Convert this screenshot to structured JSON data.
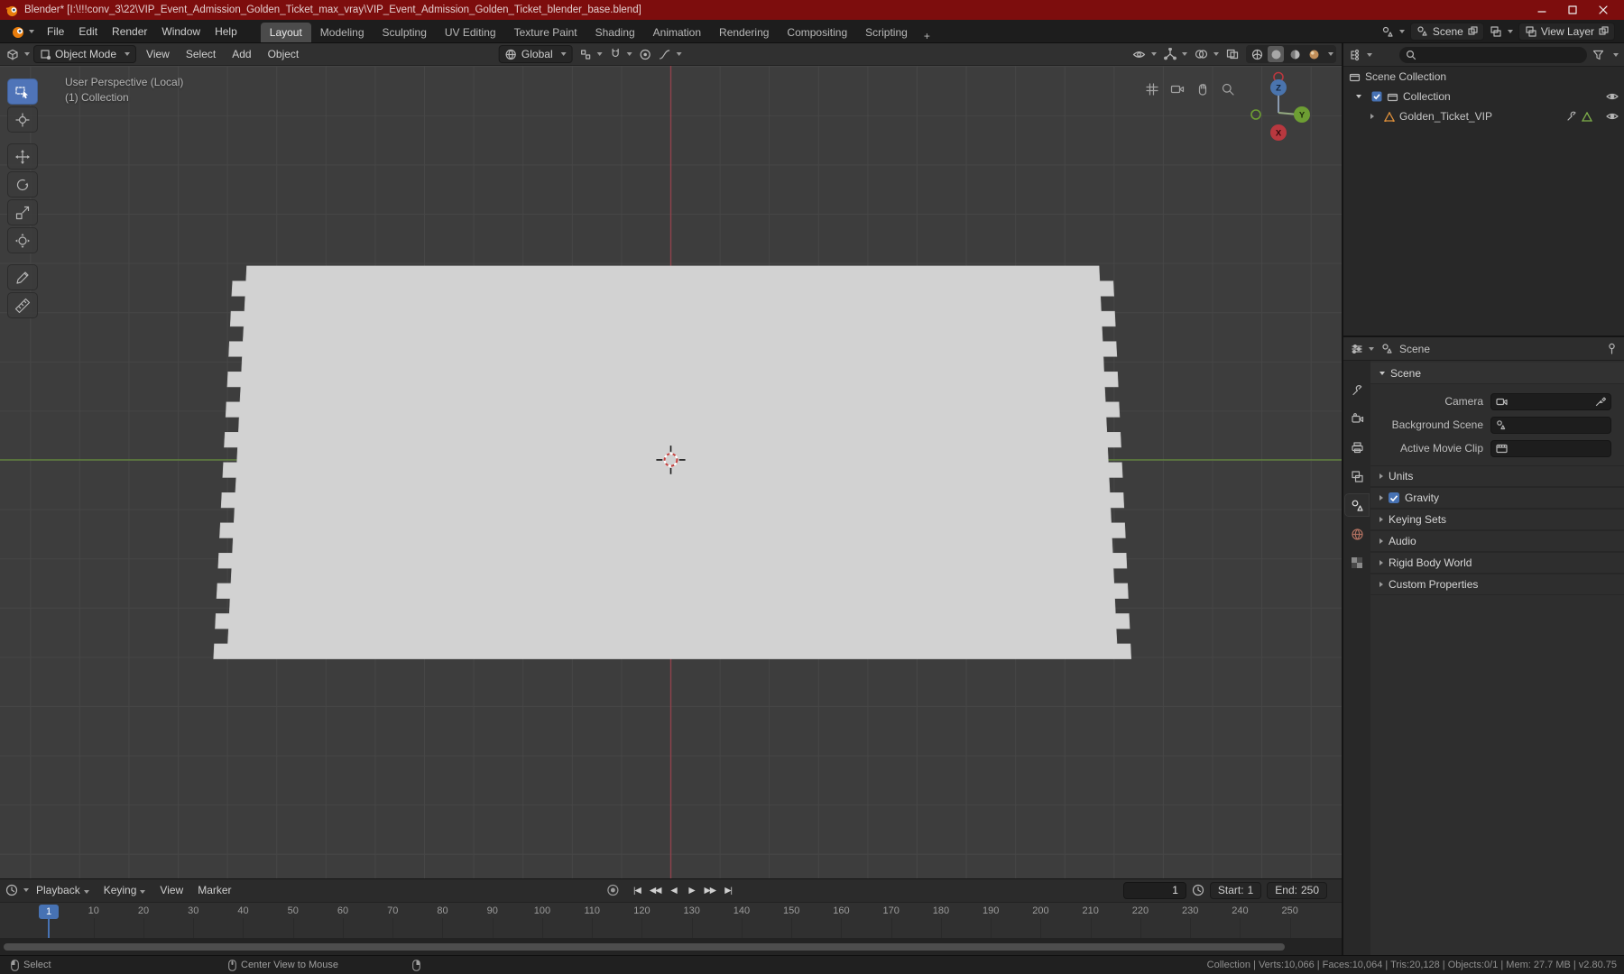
{
  "titlebar": {
    "title": "Blender* [I:\\!!!conv_3\\22\\VIP_Event_Admission_Golden_Ticket_max_vray\\VIP_Event_Admission_Golden_Ticket_blender_base.blend]"
  },
  "menubar": {
    "menus": [
      "File",
      "Edit",
      "Render",
      "Window",
      "Help"
    ],
    "workspaces": [
      "Layout",
      "Modeling",
      "Sculpting",
      "UV Editing",
      "Texture Paint",
      "Shading",
      "Animation",
      "Rendering",
      "Compositing",
      "Scripting"
    ],
    "active_workspace": "Layout",
    "add_tab": "+",
    "scene_selector": "Scene",
    "view_layer_selector": "View Layer"
  },
  "viewport_header": {
    "mode": "Object Mode",
    "menus": [
      "View",
      "Select",
      "Add",
      "Object"
    ],
    "orientation": "Global"
  },
  "viewport_overlay": {
    "line1": "User Perspective (Local)",
    "line2": "(1) Collection"
  },
  "gizmo": {
    "x": "X",
    "y": "Y",
    "z": "Z"
  },
  "outliner": {
    "rows": [
      {
        "label": "Scene Collection"
      },
      {
        "label": "Collection"
      },
      {
        "label": "Golden_Ticket_VIP"
      }
    ]
  },
  "properties": {
    "breadcrumb": "Scene",
    "scene_panel": {
      "title": "Scene",
      "fields": [
        {
          "label": "Camera"
        },
        {
          "label": "Background Scene"
        },
        {
          "label": "Active Movie Clip"
        }
      ]
    },
    "collapsed_panels": [
      {
        "label": "Units"
      },
      {
        "label": "Gravity",
        "checked": true
      },
      {
        "label": "Keying Sets"
      },
      {
        "label": "Audio"
      },
      {
        "label": "Rigid Body World"
      },
      {
        "label": "Custom Properties"
      }
    ]
  },
  "timeline": {
    "menus": [
      "Playback",
      "Keying",
      "View",
      "Marker"
    ],
    "transport": [
      "|◀",
      "◀◀",
      "◀",
      "▶",
      "▶▶",
      "▶|"
    ],
    "current_frame": "1",
    "start_label": "Start:",
    "start_value": "1",
    "end_label": "End:",
    "end_value": "250",
    "playhead_frame": "1",
    "ticks": [
      10,
      20,
      30,
      40,
      50,
      60,
      70,
      80,
      90,
      100,
      110,
      120,
      130,
      140,
      150,
      160,
      170,
      180,
      190,
      200,
      210,
      220,
      230,
      240,
      250
    ]
  },
  "statusbar": {
    "select_label": "Select",
    "center_view_label": "Center View to Mouse",
    "stats": "Collection | Verts:10,066 | Faces:10,064 | Tris:20,128 | Objects:0/1 | Mem: 27.7 MB | v2.80.75"
  },
  "colors": {
    "titlebar_red": "#7d0d0d",
    "accent_blue": "#4772b3",
    "blender_orange": "#e87d0d",
    "axis_x": "#b8383f",
    "axis_y": "#6d9e33",
    "axis_z": "#4a74ad",
    "ticket_fill": "#d2d2d2",
    "viewport_bg": "#3d3d3d"
  }
}
